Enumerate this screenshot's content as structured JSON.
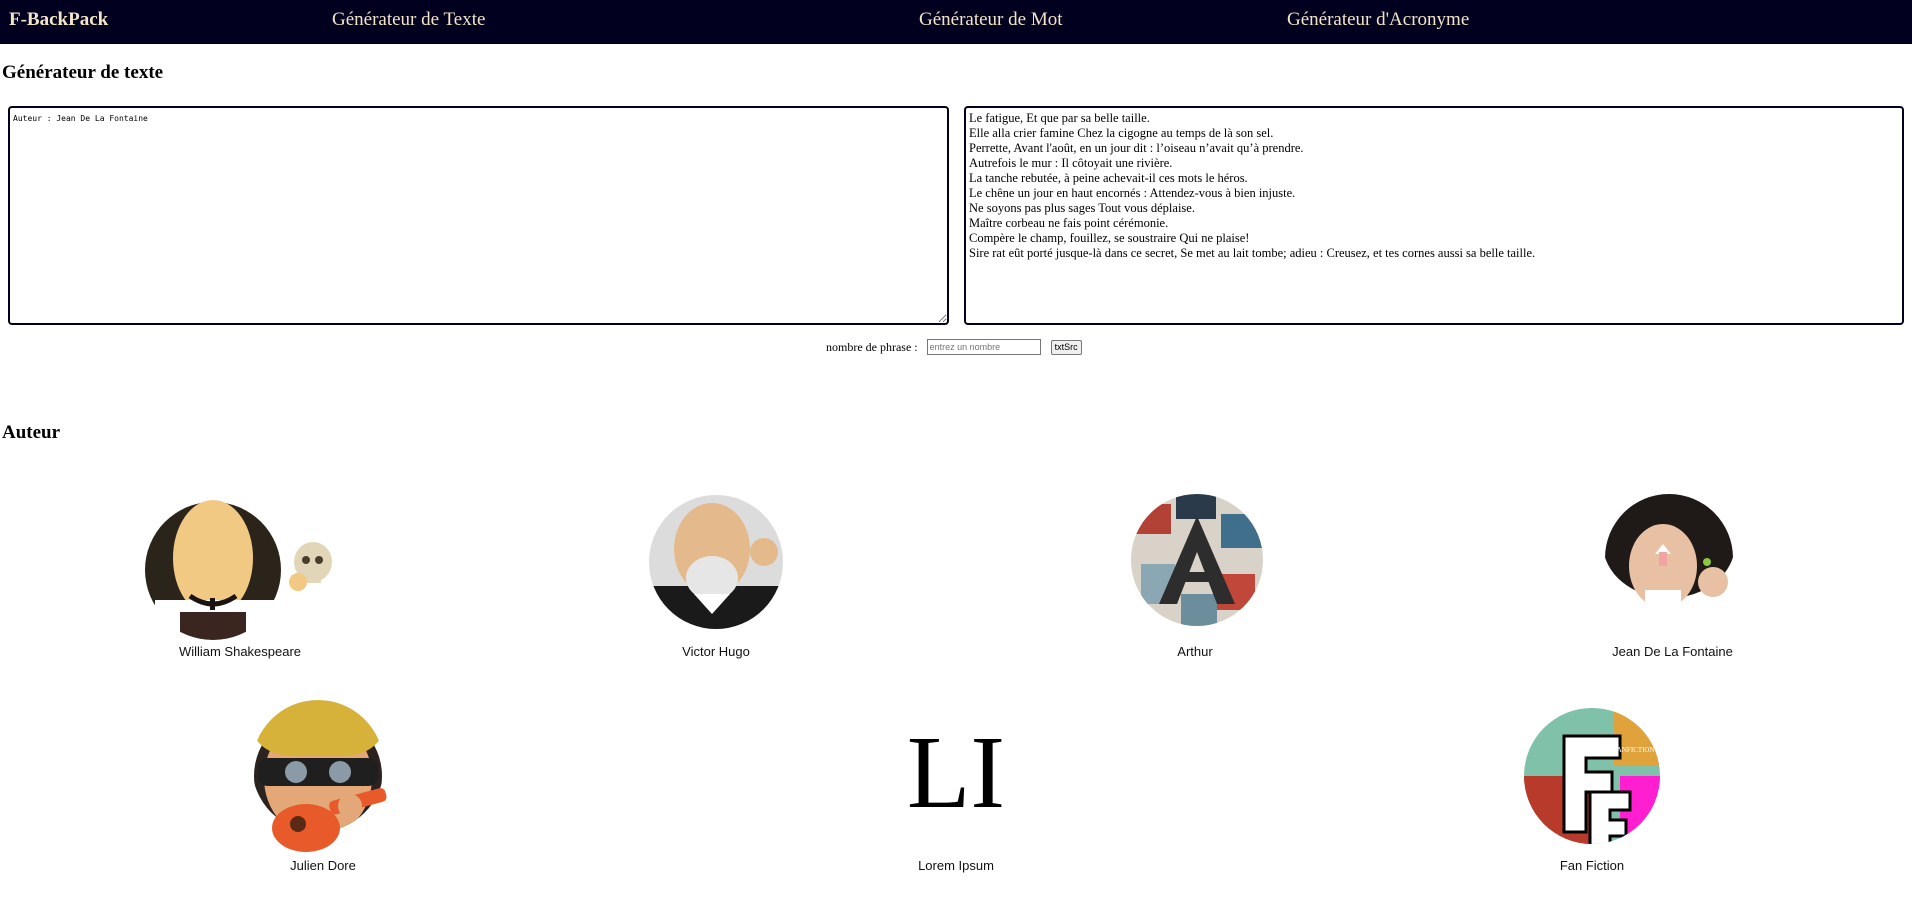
{
  "nav": {
    "brand": "F-BackPack",
    "items": [
      "Générateur de Texte",
      "Générateur de Mot",
      "Générateur d'Acronyme"
    ]
  },
  "generator": {
    "title": "Générateur de texte",
    "source_text": "Auteur : Jean De La Fontaine",
    "output_lines": [
      "Le fatigue, Et que par sa belle taille.",
      "Elle alla crier famine Chez la cigogne au temps de là son sel.",
      "Perrette, Avant l'août, en un jour dit : l’oiseau n’avait qu’à prendre.",
      "Autrefois le mur : Il côtoyait une rivière.",
      "La tanche rebutée, à peine achevait-il ces mots le héros.",
      "Le chêne un jour en haut encornés : Attendez-vous à bien injuste.",
      "Ne soyons pas plus sages Tout vous déplaise.",
      "Maître corbeau ne fais point cérémonie.",
      "Compère le champ, fouillez, se soustraire Qui ne plaise!",
      "Sire rat eût porté jusque-là dans ce secret, Se met au lait tombe; adieu : Creusez, et tes cornes aussi sa belle taille."
    ],
    "count_label": "nombre de phrase :",
    "count_placeholder": "entrez un nombre",
    "submit_label": "txtSrc"
  },
  "authors_section": {
    "title": "Auteur",
    "authors": [
      {
        "name": "William Shakespeare",
        "icon": "shakespeare-avatar-icon"
      },
      {
        "name": "Victor Hugo",
        "icon": "victor-hugo-avatar-icon"
      },
      {
        "name": "Arthur",
        "icon": "arthur-avatar-icon"
      },
      {
        "name": "Jean De La Fontaine",
        "icon": "la-fontaine-avatar-icon"
      },
      {
        "name": "Julien Dore",
        "icon": "julien-dore-avatar-icon"
      },
      {
        "name": "Lorem Ipsum",
        "icon": "lorem-ipsum-logo-icon"
      },
      {
        "name": "Fan Fiction",
        "icon": "fan-fiction-logo-icon"
      }
    ],
    "lorem_logo_text": "LI",
    "fanfiction_logo_text": "FANFICTION"
  },
  "colors": {
    "navbar_bg": "#01011f",
    "navbar_text": "#f4e4c9",
    "border": "#01011f"
  }
}
